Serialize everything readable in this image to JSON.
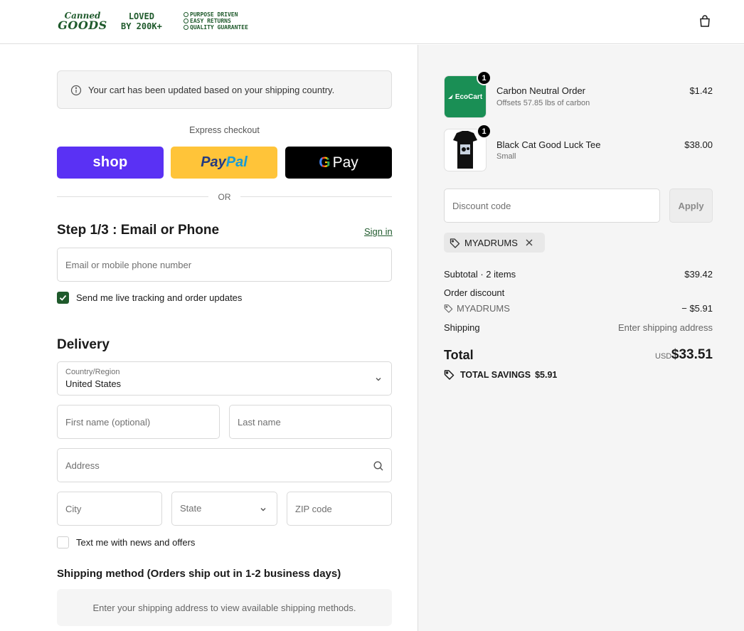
{
  "header": {
    "logo_line1": "Canned",
    "logo_line2": "GOODS",
    "loved_line1": "LOVED",
    "loved_line2": "BY 200K+",
    "badges": [
      "PURPOSE DRIVEN",
      "EASY RETURNS",
      "QUALITY GUARANTEE"
    ],
    "cart_icon": "shopping-bag-icon"
  },
  "notice": {
    "text": "Your cart has been updated based on your shipping country.",
    "icon": "info-icon"
  },
  "express": {
    "label": "Express checkout",
    "shop_label": "shop",
    "paypal_part1": "Pay",
    "paypal_part2": "Pal",
    "gpay_g": "G",
    "gpay_label": "Pay",
    "or_label": "OR"
  },
  "contact": {
    "title": "Step 1/3 : Email or Phone",
    "signin_label": "Sign in",
    "email_placeholder": "Email or mobile phone number",
    "tracking_label": "Send me live tracking and order updates",
    "tracking_checked": true
  },
  "delivery": {
    "title": "Delivery",
    "country_label": "Country/Region",
    "country_value": "United States",
    "first_name_placeholder": "First name (optional)",
    "last_name_placeholder": "Last name",
    "address_placeholder": "Address",
    "city_placeholder": "City",
    "state_placeholder": "State",
    "zip_placeholder": "ZIP code",
    "news_label": "Text me with news and offers",
    "news_checked": false
  },
  "shipping": {
    "title": "Shipping method (Orders ship out in 1-2 business days)",
    "message": "Enter your shipping address to view available shipping methods."
  },
  "summary": {
    "items": [
      {
        "thumb_label": "EcoCart",
        "qty": "1",
        "name": "Carbon Neutral Order",
        "sub": "Offsets 57.85 lbs of carbon",
        "price": "$1.42"
      },
      {
        "qty": "1",
        "name": "Black Cat Good Luck Tee",
        "sub": "Small",
        "price": "$38.00"
      }
    ],
    "discount_placeholder": "Discount code",
    "apply_label": "Apply",
    "applied_code": "MYADRUMS",
    "subtotal_label": "Subtotal · 2 items",
    "subtotal_value": "$39.42",
    "order_discount_label": "Order discount",
    "discount_code": "MYADRUMS",
    "discount_value": "− $5.91",
    "shipping_label": "Shipping",
    "shipping_value": "Enter shipping address",
    "total_label": "Total",
    "currency": "USD",
    "total_value": "$33.51",
    "savings_label": "TOTAL SAVINGS",
    "savings_value": "$5.91"
  },
  "colors": {
    "brand_green": "#1f5a2c",
    "shop_purple": "#5a31f4",
    "paypal_yellow": "#ffc439",
    "ecocart_green": "#1a8f55"
  }
}
